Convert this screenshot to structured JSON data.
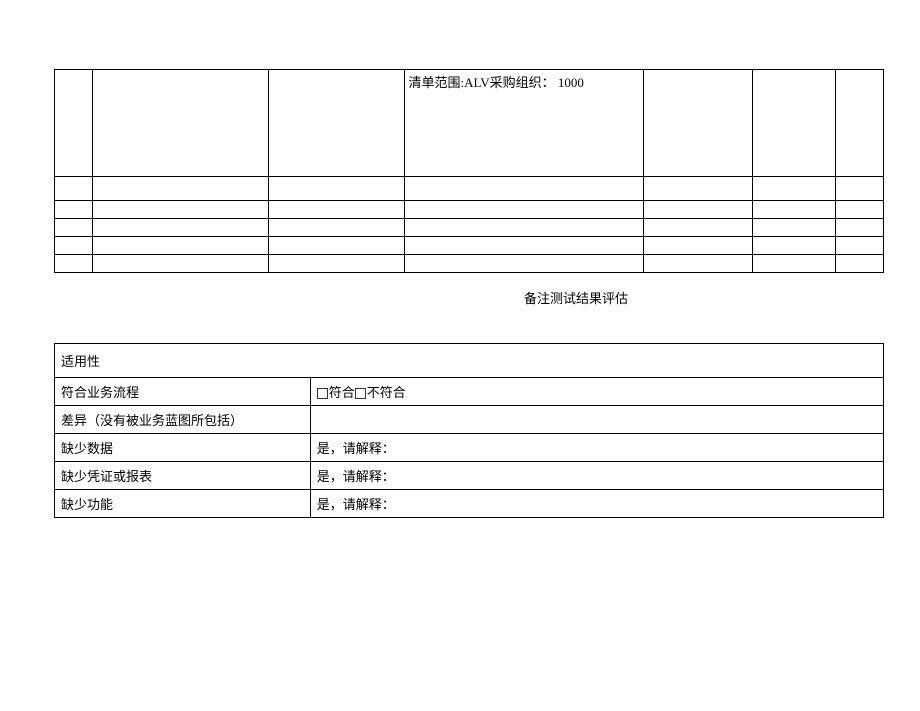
{
  "table1": {
    "cell_text": "清单范围:ALV采购组织： 1000"
  },
  "caption": "备注测试结果评估",
  "table2": {
    "rows": [
      {
        "label": "适用性",
        "value": ""
      },
      {
        "label": "符合业务流程",
        "value_prefix": "",
        "option1": "符合",
        "option2": "不符合"
      },
      {
        "label": "差异（没有被业务蓝图所包括）",
        "value": ""
      },
      {
        "label": "缺少数据",
        "value": " 是，请解释："
      },
      {
        "label": "缺少凭证或报表",
        "value": " 是，请解释："
      },
      {
        "label": "缺少功能",
        "value": " 是，请解释："
      }
    ]
  }
}
